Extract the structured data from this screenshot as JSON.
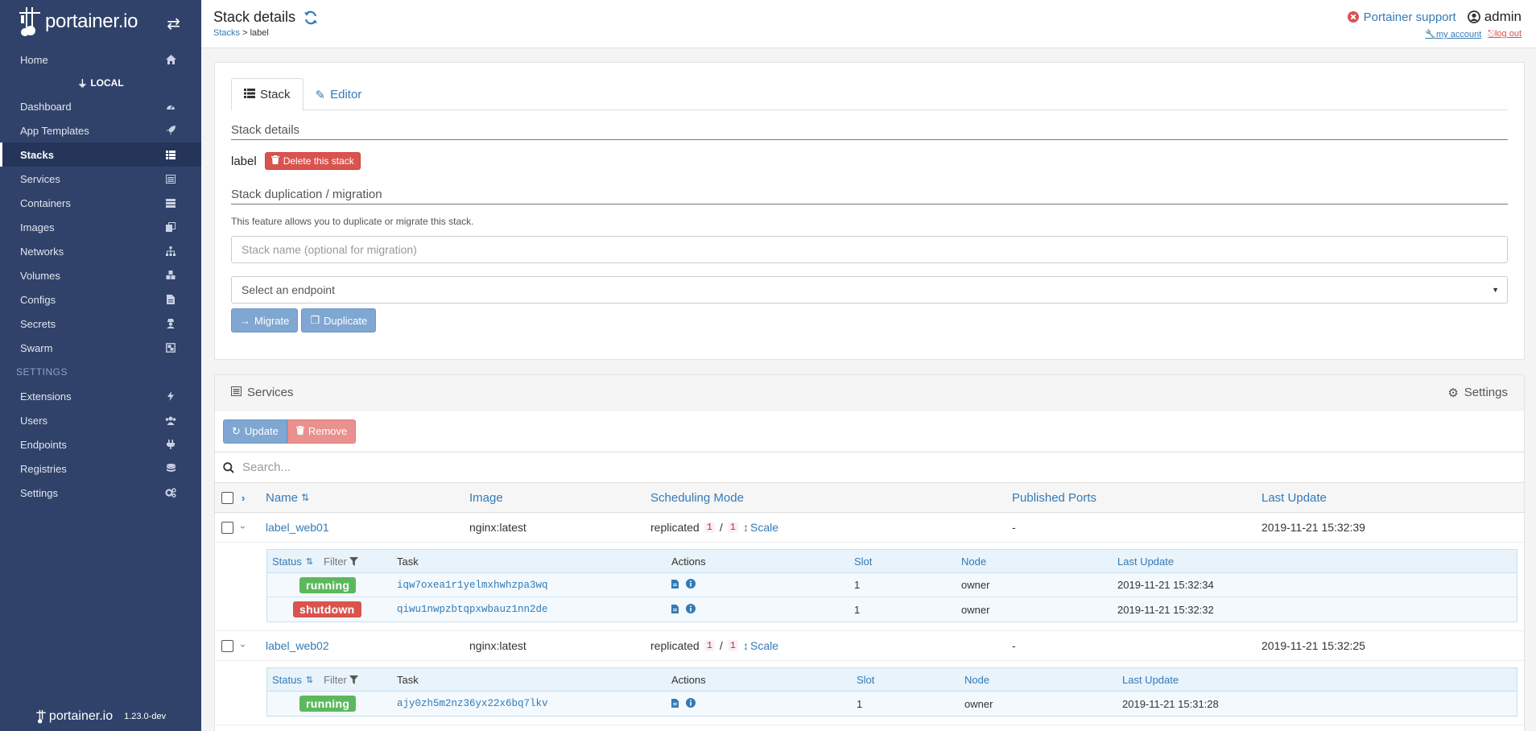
{
  "brand": {
    "name": "portainer.io",
    "version": "1.23.0-dev"
  },
  "sidebar": {
    "home": "Home",
    "endpoint": "LOCAL",
    "items": [
      {
        "label": "Dashboard",
        "icon": "dashboard-icon"
      },
      {
        "label": "App Templates",
        "icon": "rocket-icon"
      },
      {
        "label": "Stacks",
        "icon": "list-icon",
        "active": true
      },
      {
        "label": "Services",
        "icon": "services-icon"
      },
      {
        "label": "Containers",
        "icon": "server-icon"
      },
      {
        "label": "Images",
        "icon": "clone-icon"
      },
      {
        "label": "Networks",
        "icon": "sitemap-icon"
      },
      {
        "label": "Volumes",
        "icon": "cubes-icon"
      },
      {
        "label": "Configs",
        "icon": "file-icon"
      },
      {
        "label": "Secrets",
        "icon": "user-secret-icon"
      },
      {
        "label": "Swarm",
        "icon": "object-group-icon"
      }
    ],
    "settings_section": "SETTINGS",
    "settings_items": [
      {
        "label": "Extensions",
        "icon": "bolt-icon"
      },
      {
        "label": "Users",
        "icon": "users-icon"
      },
      {
        "label": "Endpoints",
        "icon": "plug-icon"
      },
      {
        "label": "Registries",
        "icon": "database-icon"
      },
      {
        "label": "Settings",
        "icon": "cogs-icon"
      }
    ]
  },
  "header": {
    "title": "Stack details",
    "breadcrumb_link": "Stacks",
    "breadcrumb_sep": ">",
    "breadcrumb_current": "label",
    "support": "Portainer support",
    "user": "admin",
    "my_account": "my account",
    "log_out": "log out"
  },
  "stack": {
    "tabs": [
      "Stack",
      "Editor"
    ],
    "details_title": "Stack details",
    "name": "label",
    "delete_label": "Delete this stack",
    "dup_title": "Stack duplication / migration",
    "dup_help": "This feature allows you to duplicate or migrate this stack.",
    "name_placeholder": "Stack name (optional for migration)",
    "endpoint_select": "Select an endpoint",
    "migrate_label": "Migrate",
    "duplicate_label": "Duplicate"
  },
  "services": {
    "title": "Services",
    "settings_label": "Settings",
    "update_label": "Update",
    "remove_label": "Remove",
    "search_placeholder": "Search...",
    "columns": [
      "Name",
      "Image",
      "Scheduling Mode",
      "Published Ports",
      "Last Update"
    ],
    "task_columns": [
      "Status",
      "Filter",
      "Task",
      "Actions",
      "Slot",
      "Node",
      "Last Update"
    ],
    "rows": [
      {
        "name": "label_web01",
        "image": "nginx:latest",
        "mode": "replicated",
        "running": "1",
        "sep": "/",
        "desired": "1",
        "scale": "Scale",
        "ports": "-",
        "updated": "2019-11-21 15:32:39",
        "tasks": [
          {
            "status": "running",
            "id": "iqw7oxea1r1yelmxhwhzpa3wq",
            "slot": "1",
            "node": "owner",
            "updated": "2019-11-21 15:32:34"
          },
          {
            "status": "shutdown",
            "id": "qiwu1nwpzbtqpxwbauz1nn2de",
            "slot": "1",
            "node": "owner",
            "updated": "2019-11-21 15:32:32"
          }
        ]
      },
      {
        "name": "label_web02",
        "image": "nginx:latest",
        "mode": "replicated",
        "running": "1",
        "sep": "/",
        "desired": "1",
        "scale": "Scale",
        "ports": "-",
        "updated": "2019-11-21 15:32:25",
        "tasks": [
          {
            "status": "running",
            "id": "ajy0zh5m2nz36yx22x6bq7lkv",
            "slot": "1",
            "node": "owner",
            "updated": "2019-11-21 15:31:28"
          }
        ]
      }
    ]
  },
  "colors": {
    "sidebar": "#30426a",
    "primary": "#337ab7",
    "danger": "#d9534f",
    "success": "#5cb85c"
  }
}
